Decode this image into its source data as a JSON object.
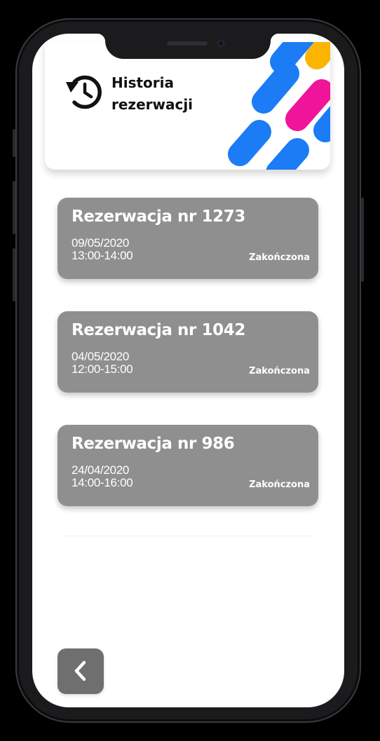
{
  "header": {
    "title": "Historia\nrezerwacji",
    "icon": "history-icon"
  },
  "colors": {
    "card_background": "#8f8f8f",
    "deco_blue": "#1b7cf5",
    "deco_pink": "#f0149a",
    "deco_yellow": "#fbb500",
    "back_button": "#6f6f70"
  },
  "reservations": [
    {
      "title": "Rezerwacja nr 1273",
      "date": "09/05/2020",
      "time": "13:00-14:00",
      "status": "Zakończona"
    },
    {
      "title": "Rezerwacja nr 1042",
      "date": "04/05/2020",
      "time": "12:00-15:00",
      "status": "Zakończona"
    },
    {
      "title": "Rezerwacja nr 986",
      "date": "24/04/2020",
      "time": "14:00-16:00",
      "status": "Zakończona"
    }
  ],
  "navigation": {
    "back_icon": "chevron-left-icon"
  }
}
